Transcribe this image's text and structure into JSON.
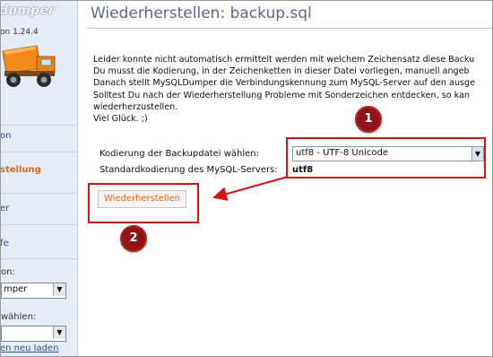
{
  "sidebar": {
    "logo_text": "dumper",
    "version": "on 1.24.4",
    "nav": [
      {
        "label": "on",
        "active": false
      },
      {
        "label": "stellung",
        "active": true
      },
      {
        "label": "er",
        "active": false
      },
      {
        "label": "fe",
        "active": false
      }
    ],
    "connection_label": "on:",
    "connection_value": "mper",
    "db_label": "wählen:",
    "db_value": "",
    "reload_link": "en neu laden"
  },
  "main": {
    "title": "Wiederherstellen: backup.sql",
    "description_lines": [
      "Leider konnte nicht automatisch ermittelt werden mit welchem Zeichensatz diese Backu",
      "Du musst die Kodierung, in der Zeichenketten in dieser Datei vorliegen, manuell angeb",
      "Danach stellt MySQLDumper die Verbindungskennung zum MySQL-Server auf den ausge",
      "Solltest Du nach der Wiederherstellung Probleme mit Sonderzeichen entdecken, so kan",
      "wiederherzustellen.",
      "Viel Glück. ;)"
    ],
    "encoding_label": "Kodierung der Backupdatei wählen:",
    "encoding_value": "utf8 - UTF-8 Unicode",
    "server_encoding_label": "Standardkodierung des MySQL-Servers:",
    "server_encoding_value": "utf8",
    "restore_button": "Wiederherstellen"
  },
  "annotations": {
    "badge1": "1",
    "badge2": "2",
    "highlight_color": "#d41414",
    "badge_color": "#8f1515"
  }
}
